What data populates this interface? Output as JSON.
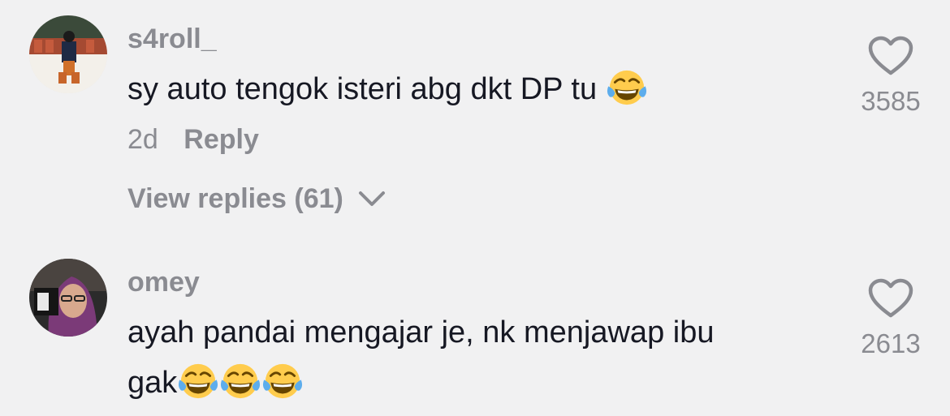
{
  "comments": [
    {
      "username": "s4roll_",
      "text": "sy auto tengok isteri abg dkt DP tu",
      "emoji": "face-with-tears-of-joy",
      "time": "2d",
      "reply_label": "Reply",
      "view_replies": "View replies (61)",
      "likes": "3585"
    },
    {
      "username": "omey",
      "text_line1": "ayah pandai mengajar je, nk menjawap ibu",
      "text_line2": "gak",
      "emoji": "face-with-tears-of-joy",
      "likes": "2613"
    }
  ],
  "colors": {
    "background": "#f1f1f2",
    "text": "#161823",
    "secondary": "#8a8b91"
  }
}
